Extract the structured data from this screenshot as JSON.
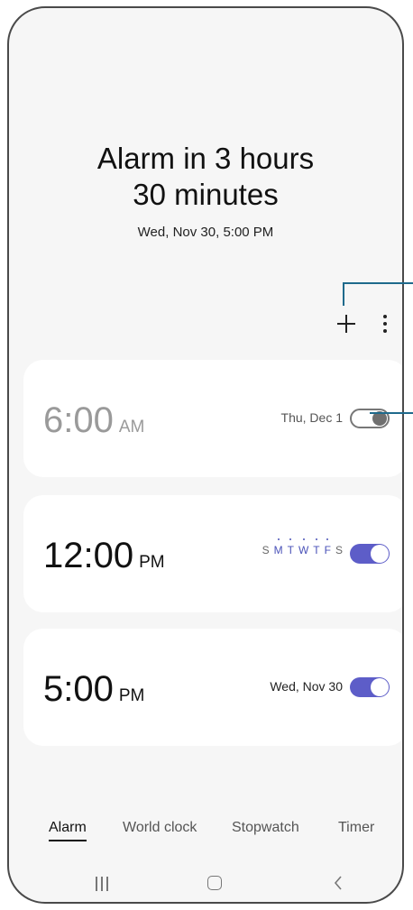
{
  "header": {
    "title_line1": "Alarm in 3 hours",
    "title_line2": "30 minutes",
    "next_alarm": "Wed, Nov 30, 5:00 PM"
  },
  "toolbar": {
    "add_icon": "plus-icon",
    "more_icon": "more-vertical-icon"
  },
  "alarms": [
    {
      "time": "6:00",
      "ampm": "AM",
      "when": "Thu, Dec 1",
      "enabled": false
    },
    {
      "time": "12:00",
      "ampm": "PM",
      "days": [
        "S",
        "M",
        "T",
        "W",
        "T",
        "F",
        "S"
      ],
      "active_days": [
        false,
        true,
        true,
        true,
        true,
        true,
        false
      ],
      "enabled": true
    },
    {
      "time": "5:00",
      "ampm": "PM",
      "when": "Wed, Nov 30",
      "enabled": true
    }
  ],
  "tabs": [
    "Alarm",
    "World clock",
    "Stopwatch",
    "Timer"
  ],
  "active_tab": "Alarm",
  "navbar": {
    "recent_icon": "recent-apps-icon",
    "home_icon": "home-icon",
    "back_icon": "back-icon"
  },
  "colors": {
    "accent": "#5d5dc8",
    "background": "#f6f6f6",
    "card": "#ffffff",
    "callout": "#1f6a8c"
  }
}
